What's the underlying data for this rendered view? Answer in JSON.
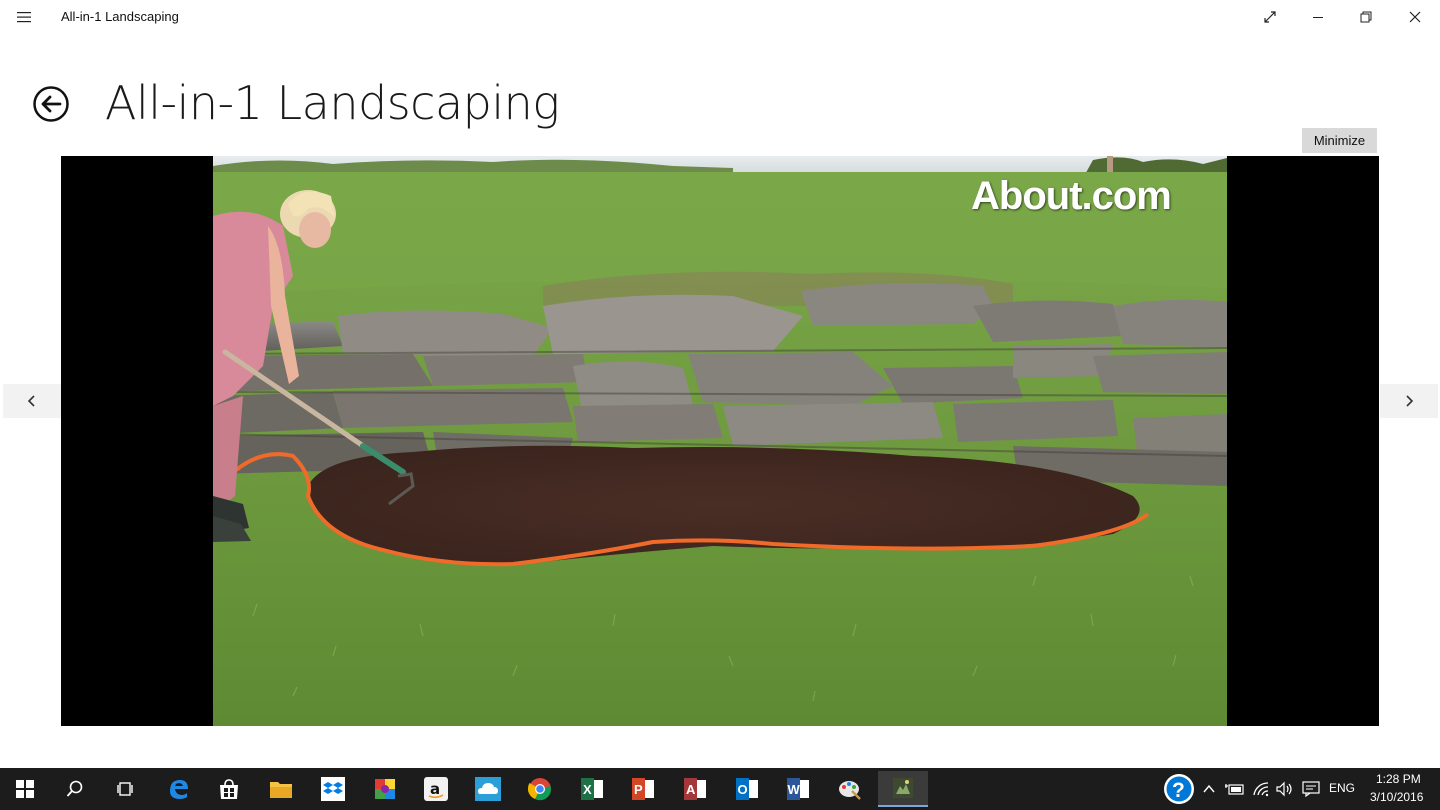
{
  "window": {
    "title": "All-in-1 Landscaping"
  },
  "page": {
    "title": "All-in-1 Landscaping",
    "minimize_label": "Minimize"
  },
  "viewer": {
    "watermark": "About.com",
    "prev_icon": "chevron-left-icon",
    "next_icon": "chevron-right-icon"
  },
  "taskbar": {
    "apps": [
      "start",
      "search",
      "task-view",
      "edge",
      "store",
      "file-explorer",
      "dropbox",
      "photos",
      "amazon",
      "onedrive",
      "chrome",
      "excel",
      "powerpoint",
      "access",
      "outlook",
      "word",
      "paint",
      "landscaping-app"
    ],
    "language": "ENG",
    "time": "1:28 PM",
    "date": "3/10/2016"
  },
  "colors": {
    "accent": "#0078d7",
    "excel": "#1e7145",
    "powerpoint": "#d24726",
    "access": "#a4373a",
    "outlook": "#0072c6",
    "word": "#2b579a",
    "grass": "#6e9a3e",
    "hose": "#f26b2a"
  }
}
